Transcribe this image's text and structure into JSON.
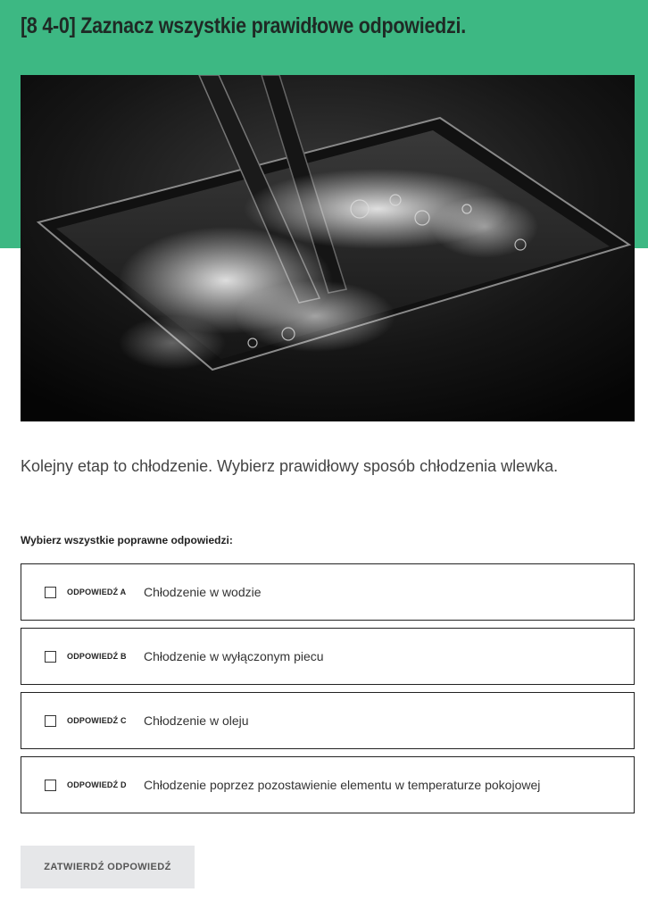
{
  "header": {
    "title": "[8 4-0] Zaznacz wszystkie prawidłowe odpowiedzi."
  },
  "hero": {
    "description": "photo"
  },
  "question": {
    "text": "Kolejny etap to chłodzenie. Wybierz prawidłowy sposób chłodzenia wlewka."
  },
  "instruction": "Wybierz wszystkie poprawne odpowiedzi:",
  "options": [
    {
      "tag": "ODPOWIEDŹ A",
      "text": "Chłodzenie w wodzie",
      "checked": false
    },
    {
      "tag": "ODPOWIEDŹ B",
      "text": "Chłodzenie w wyłączonym piecu",
      "checked": false
    },
    {
      "tag": "ODPOWIEDŹ C",
      "text": "Chłodzenie w oleju",
      "checked": false
    },
    {
      "tag": "ODPOWIEDŹ D",
      "text": "Chłodzenie poprzez pozostawienie elementu w temperaturze pokojowej",
      "checked": false
    }
  ],
  "submit": {
    "label": "ZATWIERDŹ ODPOWIEDŹ"
  },
  "colors": {
    "header_green": "#3db883",
    "submit_bg": "#e6e7e9"
  }
}
